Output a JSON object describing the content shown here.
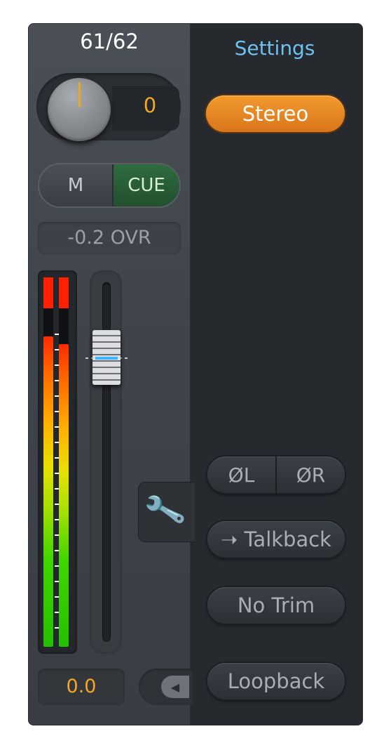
{
  "channel": {
    "count_label": "61/62",
    "gain_value": "0",
    "mute_label": "M",
    "cue_label": "CUE",
    "level_readout": "-0.2  OVR",
    "volume_readout": "0.0"
  },
  "meter": {
    "left_level": 0.84,
    "right_level": 0.82
  },
  "settings": {
    "title": "Settings",
    "stereo_label": "Stereo",
    "phase_left_label": "ØL",
    "phase_right_label": "ØR",
    "talkback_label": "➝ Talkback",
    "no_trim_label": "No Trim",
    "loopback_label": "Loopback"
  },
  "colors": {
    "accent_orange": "#d9751a",
    "value_orange": "#f5a623",
    "settings_blue": "#6ec1f0",
    "cue_green": "#2f6b3f",
    "fader_line_blue": "#3cb7ff"
  },
  "icons": {
    "wrench": "wrench-icon",
    "collapse": "chevron-left-icon"
  }
}
